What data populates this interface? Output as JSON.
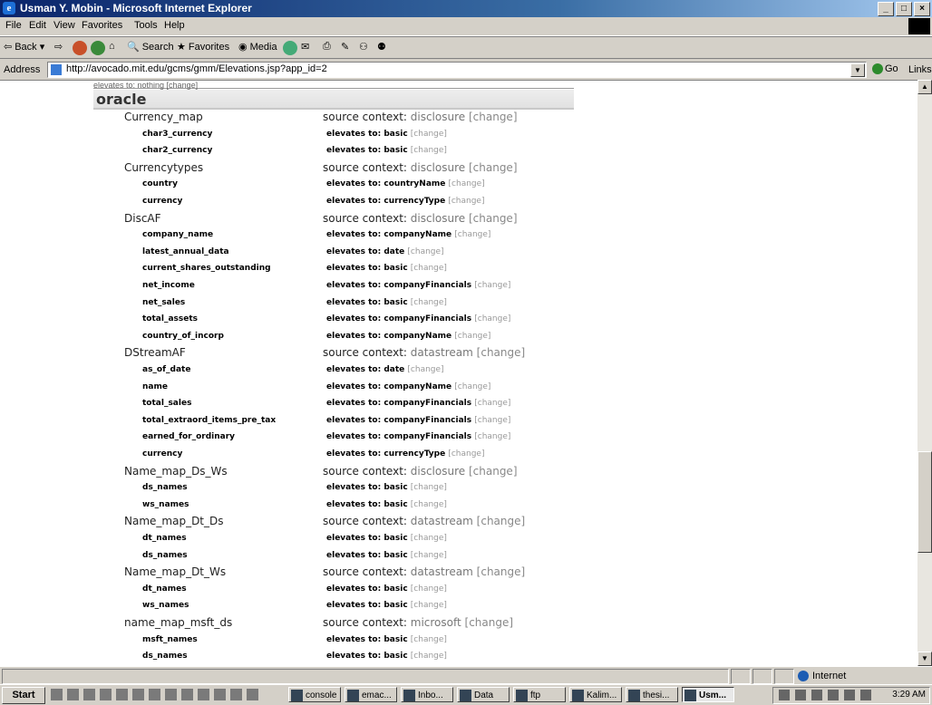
{
  "window": {
    "title": "Usman Y. Mobin - Microsoft Internet Explorer",
    "min": "_",
    "max": "□",
    "close": "×"
  },
  "menu": [
    "File",
    "Edit",
    "View",
    "Favorites",
    "Tools",
    "Help"
  ],
  "toolbar": {
    "back": "Back",
    "search": "Search",
    "favorites": "Favorites",
    "media": "Media"
  },
  "address": {
    "label": "Address",
    "url": "http://avocado.mit.edu/gcms/gmm/Elevations.jsp?app_id=2",
    "go": "Go",
    "links": "Links"
  },
  "page": {
    "prev_line": "elevates to: nothing [change]",
    "schema_name": "oracle",
    "change_label": "[change]",
    "source_prefix": "source context: ",
    "elev_prefix": "elevates to: ",
    "tables": [
      {
        "name": "Currency_map",
        "context": "disclosure",
        "columns": [
          {
            "name": "char3_currency",
            "elevates": "basic"
          },
          {
            "name": "char2_currency",
            "elevates": "basic"
          }
        ]
      },
      {
        "name": "Currencytypes",
        "context": "disclosure",
        "columns": [
          {
            "name": "country",
            "elevates": "countryName"
          },
          {
            "name": "currency",
            "elevates": "currencyType"
          }
        ]
      },
      {
        "name": "DiscAF",
        "context": "disclosure",
        "columns": [
          {
            "name": "company_name",
            "elevates": "companyName"
          },
          {
            "name": "latest_annual_data",
            "elevates": "date"
          },
          {
            "name": "current_shares_outstanding",
            "elevates": "basic"
          },
          {
            "name": "net_income",
            "elevates": "companyFinancials"
          },
          {
            "name": "net_sales",
            "elevates": "basic"
          },
          {
            "name": "total_assets",
            "elevates": "companyFinancials"
          },
          {
            "name": "country_of_incorp",
            "elevates": "companyName"
          }
        ]
      },
      {
        "name": "DStreamAF",
        "context": "datastream",
        "columns": [
          {
            "name": "as_of_date",
            "elevates": "date"
          },
          {
            "name": "name",
            "elevates": "companyName"
          },
          {
            "name": "total_sales",
            "elevates": "companyFinancials"
          },
          {
            "name": "total_extraord_items_pre_tax",
            "elevates": "companyFinancials"
          },
          {
            "name": "earned_for_ordinary",
            "elevates": "companyFinancials"
          },
          {
            "name": "currency",
            "elevates": "currencyType"
          }
        ]
      },
      {
        "name": "Name_map_Ds_Ws",
        "context": "disclosure",
        "columns": [
          {
            "name": "ds_names",
            "elevates": "basic"
          },
          {
            "name": "ws_names",
            "elevates": "basic"
          }
        ]
      },
      {
        "name": "Name_map_Dt_Ds",
        "context": "datastream",
        "columns": [
          {
            "name": "dt_names",
            "elevates": "basic"
          },
          {
            "name": "ds_names",
            "elevates": "basic"
          }
        ]
      },
      {
        "name": "Name_map_Dt_Ws",
        "context": "datastream",
        "columns": [
          {
            "name": "dt_names",
            "elevates": "basic"
          },
          {
            "name": "ws_names",
            "elevates": "basic"
          }
        ]
      },
      {
        "name": "name_map_msft_ds",
        "context": "microsoft",
        "columns": [
          {
            "name": "msft_names",
            "elevates": "basic"
          },
          {
            "name": "ds_names",
            "elevates": "basic"
          }
        ]
      }
    ]
  },
  "status": {
    "zone": "Internet"
  },
  "taskbar": {
    "start": "Start",
    "tasks": [
      "console",
      "emac...",
      "Inbo...",
      "Data",
      "ftp",
      "Kalim...",
      "thesi...",
      "Usm..."
    ],
    "clock": "3:29 AM"
  }
}
